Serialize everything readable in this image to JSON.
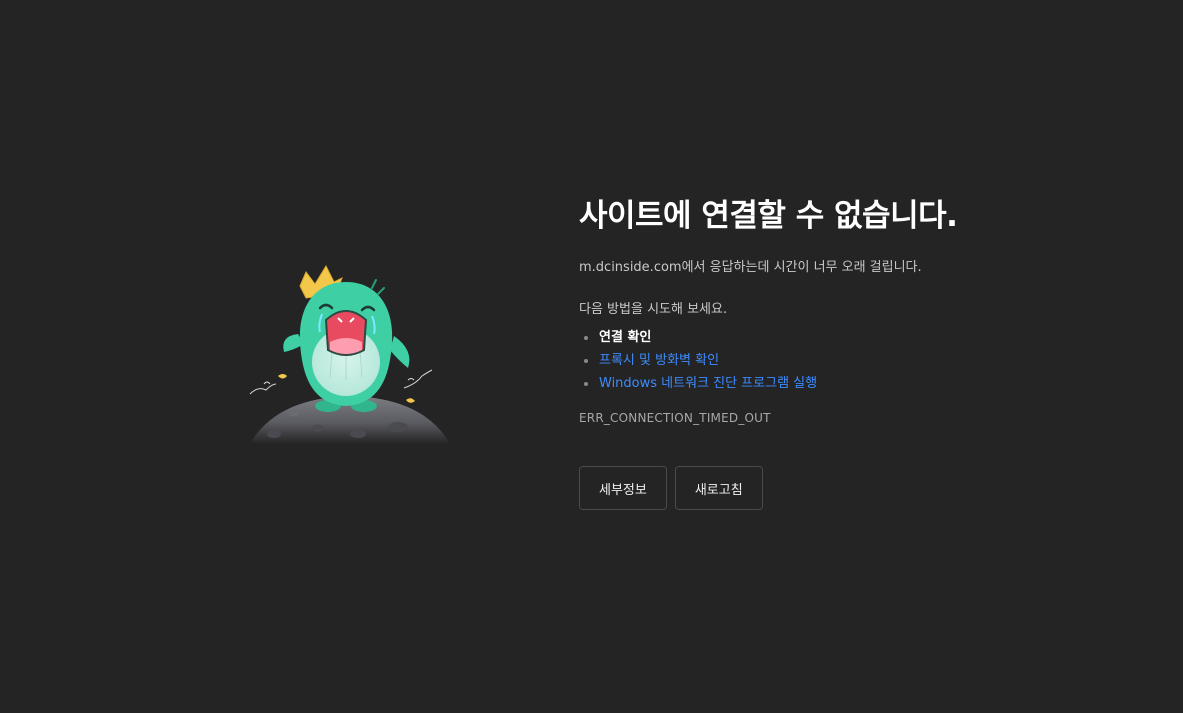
{
  "title": "사이트에 연결할 수 없습니다.",
  "description": "m.dcinside.com에서 응답하는데 시간이 너무 오래 걸립니다.",
  "try_label": "다음 방법을 시도해 보세요.",
  "suggestions": [
    {
      "label": "연결 확인",
      "link": false
    },
    {
      "label": "프록시 및 방화벽 확인",
      "link": true
    },
    {
      "label": "Windows 네트워크 진단 프로그램 실행",
      "link": true
    }
  ],
  "error_code": "ERR_CONNECTION_TIMED_OUT",
  "buttons": {
    "details": "세부정보",
    "reload": "새로고침"
  },
  "colors": {
    "background": "#242424",
    "link": "#3d8bff",
    "title": "#ffffff",
    "mascot": "#3ecfa4"
  },
  "illustration": {
    "icon": "crying-dinosaur-mascot-on-moon"
  }
}
